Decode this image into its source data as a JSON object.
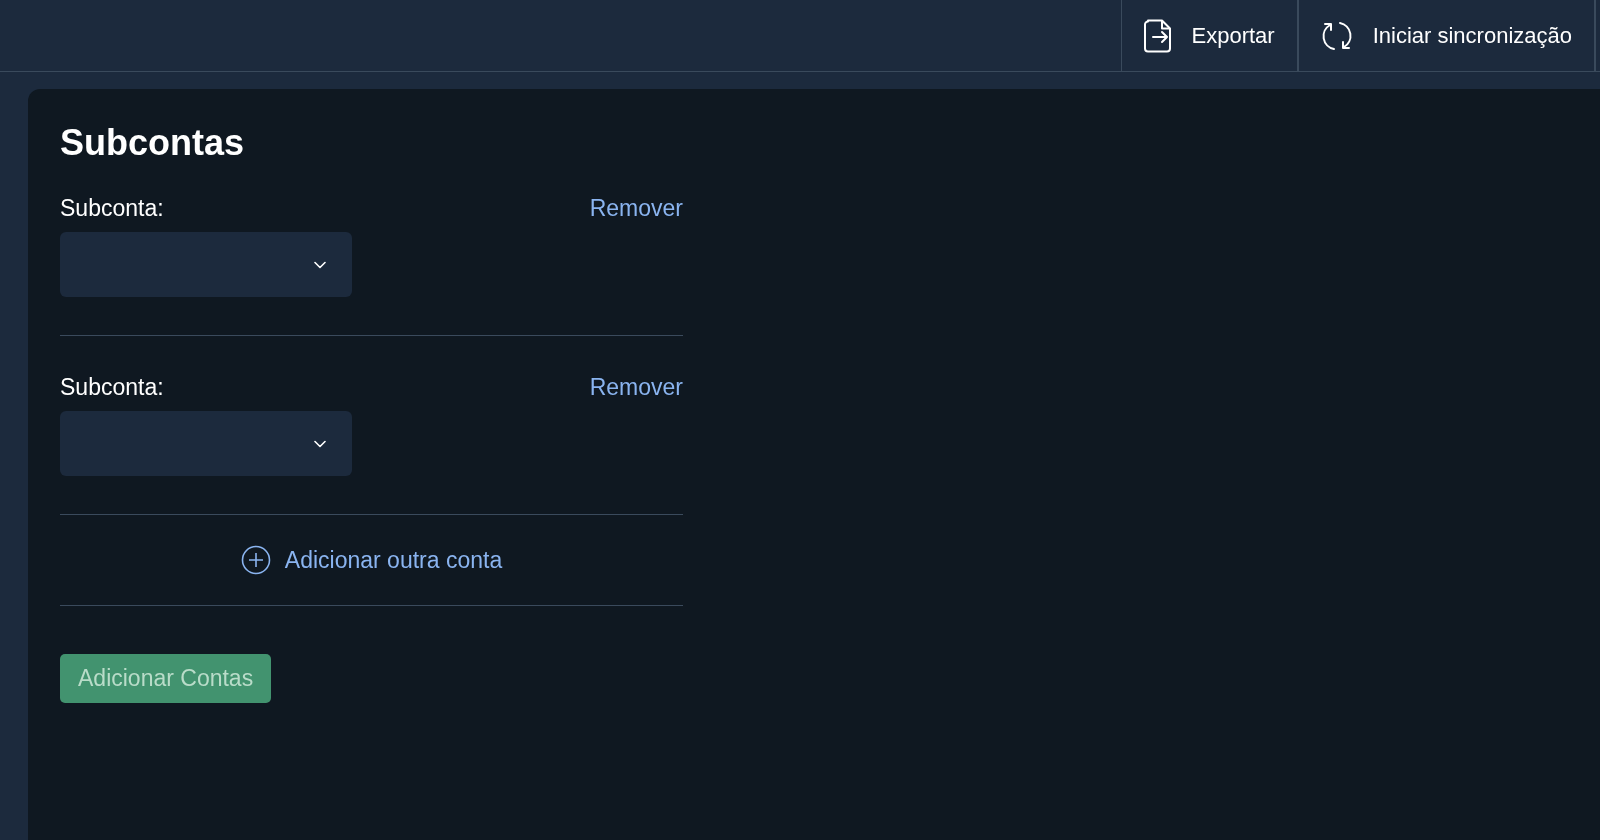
{
  "toolbar": {
    "buttons": [
      {
        "kind": "export",
        "label": "Exportar"
      },
      {
        "kind": "sync",
        "label": "Iniciar sincronização"
      }
    ]
  },
  "panel": {
    "title": "Subcontas",
    "subaccounts": [
      {
        "label": "Subconta:",
        "remove": "Remover"
      },
      {
        "label": "Subconta:",
        "remove": "Remover"
      }
    ],
    "add_link": "Adicionar outra conta",
    "submit": {
      "label": "Adicionar Contas",
      "disabled": true
    }
  }
}
